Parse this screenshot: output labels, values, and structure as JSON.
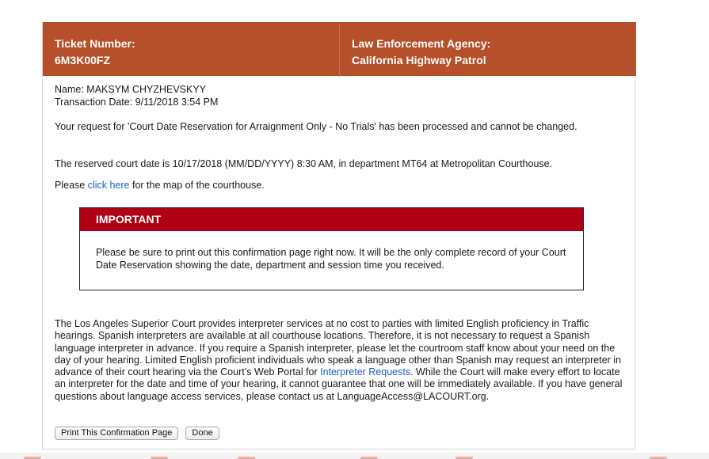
{
  "header": {
    "ticket_label": "Ticket Number:",
    "ticket_value": "6M3K00FZ",
    "agency_label": "Law Enforcement Agency:",
    "agency_value": "California Highway Patrol"
  },
  "info": {
    "name_line": "Name: MAKSYM CHYZHEVSKYY",
    "transaction_line": "Transaction Date: 9/11/2018 3:54 PM"
  },
  "messages": {
    "processed": "Your request for 'Court Date Reservation for Arraignment Only - No Trials' has been processed and cannot be changed.",
    "reserved": "The reserved court date is 10/17/2018 (MM/DD/YYYY) 8:30 AM, in department MT64 at Metropolitan Courthouse.",
    "map_prefix": "Please ",
    "map_link": "click here",
    "map_suffix": " for the map of the courthouse."
  },
  "important": {
    "title": "IMPORTANT",
    "body": "Please be sure to print out this confirmation page right now. It will be the only complete record of your Court Date Reservation showing the date, department and session time you received."
  },
  "interpreter": {
    "text_before": "The Los Angeles Superior Court provides interpreter services at no cost to parties with limited English proficiency in Traffic hearings. Spanish interpreters are available at all courthouse locations. Therefore, it is not necessary to request a Spanish language interpreter in advance. If you require a Spanish interpreter, please let the courtroom staff know about your need on the day of your hearing. Limited English proficient individuals who speak a language other than Spanish may request an interpreter in advance of their court hearing via the Court’s Web Portal for ",
    "link": "Interpreter Requests",
    "text_after": ". While the Court will make every effort to locate an interpreter for the date and time of your hearing, it cannot guarantee that one will be immediately available. If you have general questions about language access services, please contact us at LanguageAccess@LACOURT.org."
  },
  "buttons": {
    "print": "Print This Confirmation Page",
    "done": "Done"
  },
  "colors": {
    "header_bg": "#b5502b",
    "important_bar": "#b00014",
    "link": "#1a5ec4"
  }
}
